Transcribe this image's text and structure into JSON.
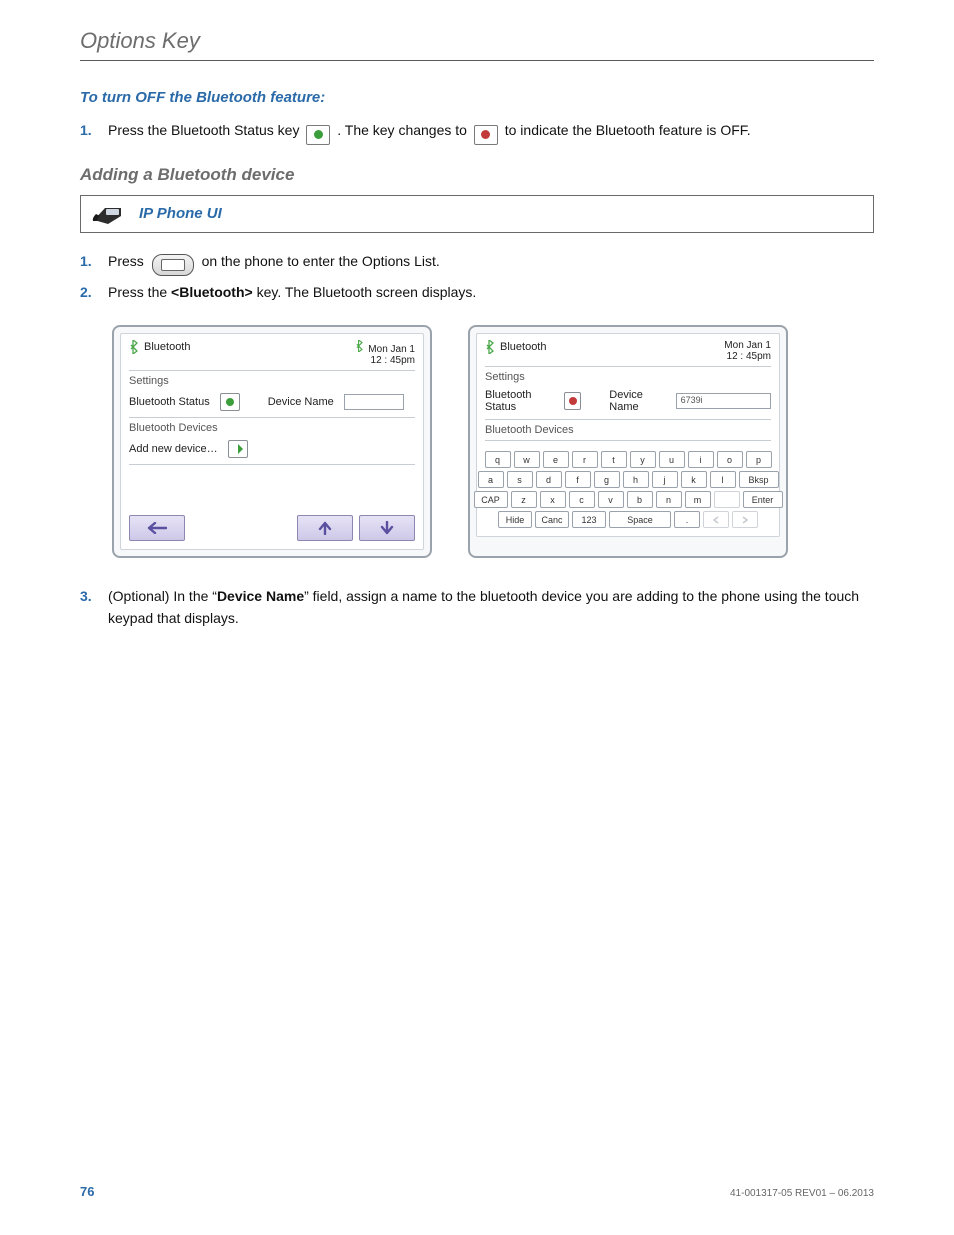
{
  "header": {
    "title": "Options Key"
  },
  "sec1": {
    "heading": "To turn OFF the Bluetooth feature:",
    "step1a": "Press the Bluetooth Status key ",
    "step1b": " . The key changes to ",
    "step1c": " to indicate the Bluetooth feature is OFF."
  },
  "sec2": {
    "heading": "Adding a Bluetooth device",
    "callout": "IP Phone UI",
    "step1a": "Press ",
    "step1b": " on the phone to enter the Options List.",
    "step2a": "Press the ",
    "step2b": "<Bluetooth>",
    "step2c": " key. The Bluetooth screen displays.",
    "step3a": "(Optional) In the “",
    "step3b": "Device Name",
    "step3c": "” field, assign a name to the bluetooth device you are adding to the phone using the touch keypad that displays."
  },
  "screen": {
    "title": "Bluetooth",
    "date": "Mon Jan 1",
    "time": "12 : 45pm",
    "settings": "Settings",
    "bt_status": "Bluetooth Status",
    "dev_name": "Device Name",
    "devices": "Bluetooth Devices",
    "add_new": "Add new device…",
    "name_val": "6739i"
  },
  "kbd": {
    "r1": [
      "q",
      "w",
      "e",
      "r",
      "t",
      "y",
      "u",
      "i",
      "o",
      "p"
    ],
    "r2": [
      "a",
      "s",
      "d",
      "f",
      "g",
      "h",
      "j",
      "k",
      "l"
    ],
    "bksp": "Bksp",
    "cap": "CAP",
    "r3": [
      "z",
      "x",
      "c",
      "v",
      "b",
      "n",
      "m"
    ],
    "enter": "Enter",
    "hide": "Hide",
    "canc": "Canc",
    "n123": "123",
    "space": "Space",
    "dot": "."
  },
  "footer": {
    "page": "76",
    "docid": "41-001317-05 REV01 – 06.2013"
  },
  "nums": {
    "n1": "1.",
    "n2": "2.",
    "n3": "3."
  }
}
